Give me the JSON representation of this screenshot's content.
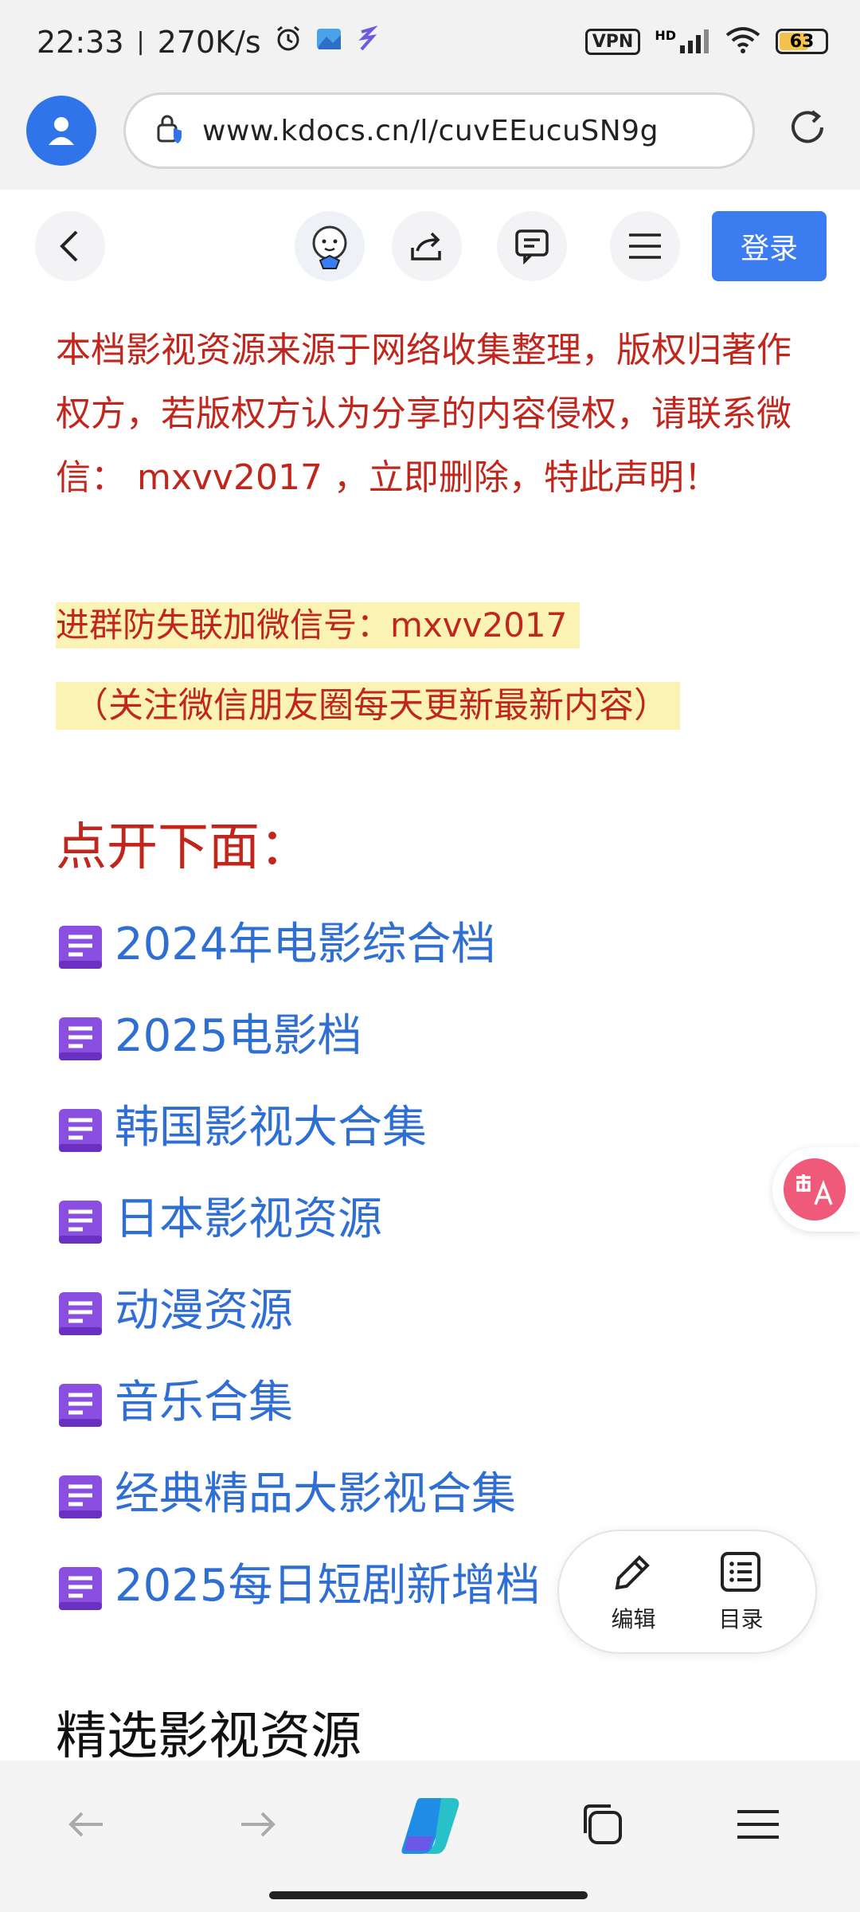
{
  "status_bar": {
    "time": "22:33",
    "speed": "270K/s",
    "vpn": "VPN",
    "hd": "HD",
    "battery": "63"
  },
  "browser": {
    "url": "www.kdocs.cn/l/cuvEEucuSN9g"
  },
  "toolbar": {
    "login_label": "登录"
  },
  "content": {
    "notice": "本档影视资源来源于网络收集整理，版权归著作权方，若版权方认为分享的内容侵权，请联系微信： mxvv2017 ，立即删除，特此声明！",
    "highlight_1": "进群防失联加微信号：mxvv2017",
    "highlight_2": "（关注微信朋友圈每天更新最新内容）",
    "section_title": "点开下面：",
    "links": [
      "2024年电影综合档",
      "2025电影档",
      "韩国影视大合集",
      "日本影视资源",
      "动漫资源",
      "音乐合集",
      "经典精品大影视合集",
      "2025每日短剧新增档"
    ],
    "section2_title": "精选影视资源"
  },
  "fab": {
    "edit_label": "编辑",
    "toc_label": "目录"
  },
  "colors": {
    "accent_blue": "#3b7cf0",
    "link_blue": "#2f6fd3",
    "notice_red": "#c0261c",
    "highlight_yellow": "#fbf3b4",
    "doc_icon_purple": "#8a4fe0"
  }
}
